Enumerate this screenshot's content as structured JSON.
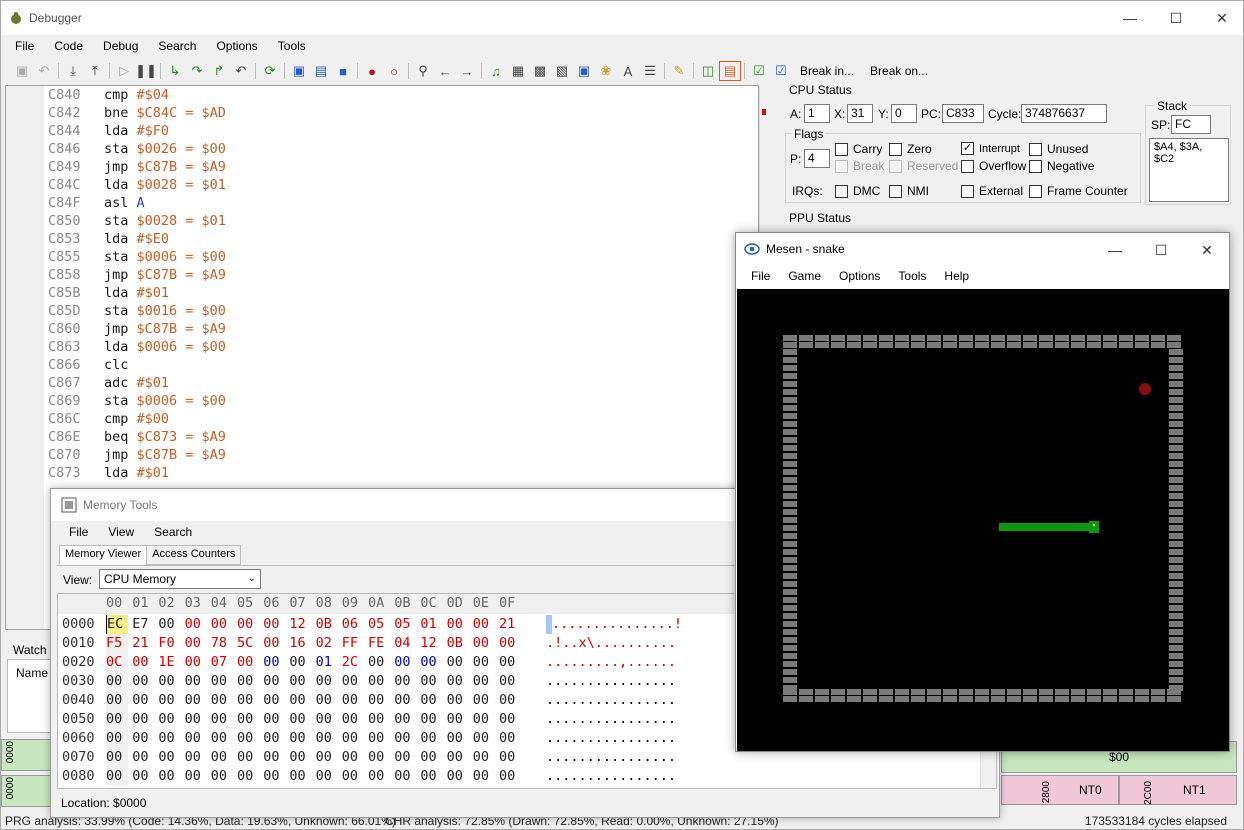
{
  "debugger": {
    "title": "Debugger",
    "menu": [
      "File",
      "Code",
      "Debug",
      "Search",
      "Options",
      "Tools"
    ],
    "toolbar_text": [
      "Break in...",
      "Break on..."
    ],
    "code_lines": [
      {
        "addr": "C840",
        "op": "cmp",
        "arg": "#$04"
      },
      {
        "addr": "C842",
        "op": "bne",
        "arg": "$C84C = $AD"
      },
      {
        "addr": "C844",
        "op": "lda",
        "arg": "#$F0"
      },
      {
        "addr": "C846",
        "op": "sta",
        "arg": "$0026 = $00"
      },
      {
        "addr": "C849",
        "op": "jmp",
        "arg": "$C87B = $A9"
      },
      {
        "addr": "C84C",
        "op": "lda",
        "arg": "$0028 = $01"
      },
      {
        "addr": "C84F",
        "op": "asl",
        "arg": "A"
      },
      {
        "addr": "C850",
        "op": "sta",
        "arg": "$0028 = $01"
      },
      {
        "addr": "C853",
        "op": "lda",
        "arg": "#$E0"
      },
      {
        "addr": "C855",
        "op": "sta",
        "arg": "$0006 = $00"
      },
      {
        "addr": "C858",
        "op": "jmp",
        "arg": "$C87B = $A9"
      },
      {
        "addr": "C85B",
        "op": "lda",
        "arg": "#$01"
      },
      {
        "addr": "C85D",
        "op": "sta",
        "arg": "$0016 = $00"
      },
      {
        "addr": "C860",
        "op": "jmp",
        "arg": "$C87B = $A9"
      },
      {
        "addr": "C863",
        "op": "lda",
        "arg": "$0006 = $00"
      },
      {
        "addr": "C866",
        "op": "clc",
        "arg": ""
      },
      {
        "addr": "C867",
        "op": "adc",
        "arg": "#$01"
      },
      {
        "addr": "C869",
        "op": "sta",
        "arg": "$0006 = $00"
      },
      {
        "addr": "C86C",
        "op": "cmp",
        "arg": "#$00"
      },
      {
        "addr": "C86E",
        "op": "beq",
        "arg": "$C873 = $A9"
      },
      {
        "addr": "C870",
        "op": "jmp",
        "arg": "$C87B = $A9"
      },
      {
        "addr": "C873",
        "op": "lda",
        "arg": "#$01"
      }
    ],
    "cpu_status": {
      "title": "CPU Status",
      "a_label": "A:",
      "a": "1",
      "x_label": "X:",
      "x": "31",
      "y_label": "Y:",
      "y": "0",
      "pc_label": "PC:",
      "pc": "C833",
      "cycle_label": "Cycle:",
      "cycle": "374876637",
      "flags_title": "Flags",
      "p_label": "P:",
      "p": "4",
      "flags": [
        {
          "name": "Carry",
          "checked": false,
          "disabled": false
        },
        {
          "name": "Zero",
          "checked": false,
          "disabled": false
        },
        {
          "name": "Interrupt",
          "checked": true,
          "disabled": false
        },
        {
          "name": "Unused",
          "checked": false,
          "disabled": false
        },
        {
          "name": "Break",
          "checked": false,
          "disabled": true
        },
        {
          "name": "Reserved",
          "checked": false,
          "disabled": true
        },
        {
          "name": "Overflow",
          "checked": false,
          "disabled": false
        },
        {
          "name": "Negative",
          "checked": false,
          "disabled": false
        }
      ],
      "irqs_label": "IRQs:",
      "irqs": [
        "DMC",
        "NMI",
        "External",
        "Frame Counter"
      ],
      "stack_title": "Stack",
      "sp_label": "SP:",
      "sp": "FC",
      "stack_values": "$A4, $3A, $C2"
    },
    "ppu_status_title": "PPU Status",
    "watch_label": "Watch",
    "watch_col_name": "Name",
    "ppu_cells": [
      "$00",
      "NT0",
      "NT1"
    ],
    "ppu_addrs": [
      "0000",
      "0000",
      "2800",
      "2C00"
    ],
    "status_prg": "PRG analysis: 33.99% (Code: 14.36%, Data: 19.63%, Unknown: 66.01%)",
    "status_chr": "CHR analysis: 72.85% (Drawn: 72.85%, Read: 0.00%, Unknown: 27.15%)",
    "status_cycles": "173533184 cycles elapsed"
  },
  "memory_tools": {
    "title": "Memory Tools",
    "menu": [
      "File",
      "View",
      "Search"
    ],
    "tabs": [
      "Memory Viewer",
      "Access Counters"
    ],
    "view_label": "View:",
    "view_value": "CPU Memory",
    "columns": [
      "00",
      "01",
      "02",
      "03",
      "04",
      "05",
      "06",
      "07",
      "08",
      "09",
      "0A",
      "0B",
      "0C",
      "0D",
      "0E",
      "0F"
    ],
    "rows": [
      {
        "addr": "0000",
        "bytes": [
          "EC",
          "E7",
          "00",
          "00",
          "00",
          "00",
          "00",
          "12",
          "0B",
          "06",
          "05",
          "05",
          "01",
          "00",
          "00",
          "21"
        ],
        "ascii": "...............!"
      },
      {
        "addr": "0010",
        "bytes": [
          "F5",
          "21",
          "F0",
          "00",
          "78",
          "5C",
          "00",
          "16",
          "02",
          "FF",
          "FE",
          "04",
          "12",
          "0B",
          "00",
          "00"
        ],
        "ascii": ".!..x\\.........."
      },
      {
        "addr": "0020",
        "bytes": [
          "0C",
          "00",
          "1E",
          "00",
          "07",
          "00",
          "00",
          "00",
          "01",
          "2C",
          "00",
          "00",
          "00",
          "00",
          "00",
          "00"
        ],
        "ascii": ".........,......"
      },
      {
        "addr": "0030",
        "bytes": [
          "00",
          "00",
          "00",
          "00",
          "00",
          "00",
          "00",
          "00",
          "00",
          "00",
          "00",
          "00",
          "00",
          "00",
          "00",
          "00"
        ],
        "ascii": "................"
      },
      {
        "addr": "0040",
        "bytes": [
          "00",
          "00",
          "00",
          "00",
          "00",
          "00",
          "00",
          "00",
          "00",
          "00",
          "00",
          "00",
          "00",
          "00",
          "00",
          "00"
        ],
        "ascii": "................"
      },
      {
        "addr": "0050",
        "bytes": [
          "00",
          "00",
          "00",
          "00",
          "00",
          "00",
          "00",
          "00",
          "00",
          "00",
          "00",
          "00",
          "00",
          "00",
          "00",
          "00"
        ],
        "ascii": "................"
      },
      {
        "addr": "0060",
        "bytes": [
          "00",
          "00",
          "00",
          "00",
          "00",
          "00",
          "00",
          "00",
          "00",
          "00",
          "00",
          "00",
          "00",
          "00",
          "00",
          "00"
        ],
        "ascii": "................"
      },
      {
        "addr": "0070",
        "bytes": [
          "00",
          "00",
          "00",
          "00",
          "00",
          "00",
          "00",
          "00",
          "00",
          "00",
          "00",
          "00",
          "00",
          "00",
          "00",
          "00"
        ],
        "ascii": "................"
      },
      {
        "addr": "0080",
        "bytes": [
          "00",
          "00",
          "00",
          "00",
          "00",
          "00",
          "00",
          "00",
          "00",
          "00",
          "00",
          "00",
          "00",
          "00",
          "00",
          "00"
        ],
        "ascii": "................"
      }
    ],
    "location": "Location: $0000"
  },
  "mesen": {
    "title": "Mesen - snake",
    "menu": [
      "File",
      "Game",
      "Options",
      "Tools",
      "Help"
    ],
    "colors": {
      "wall": "#7a7a7a",
      "snake": "#0c9a0c",
      "apple": "#8a1010"
    }
  }
}
